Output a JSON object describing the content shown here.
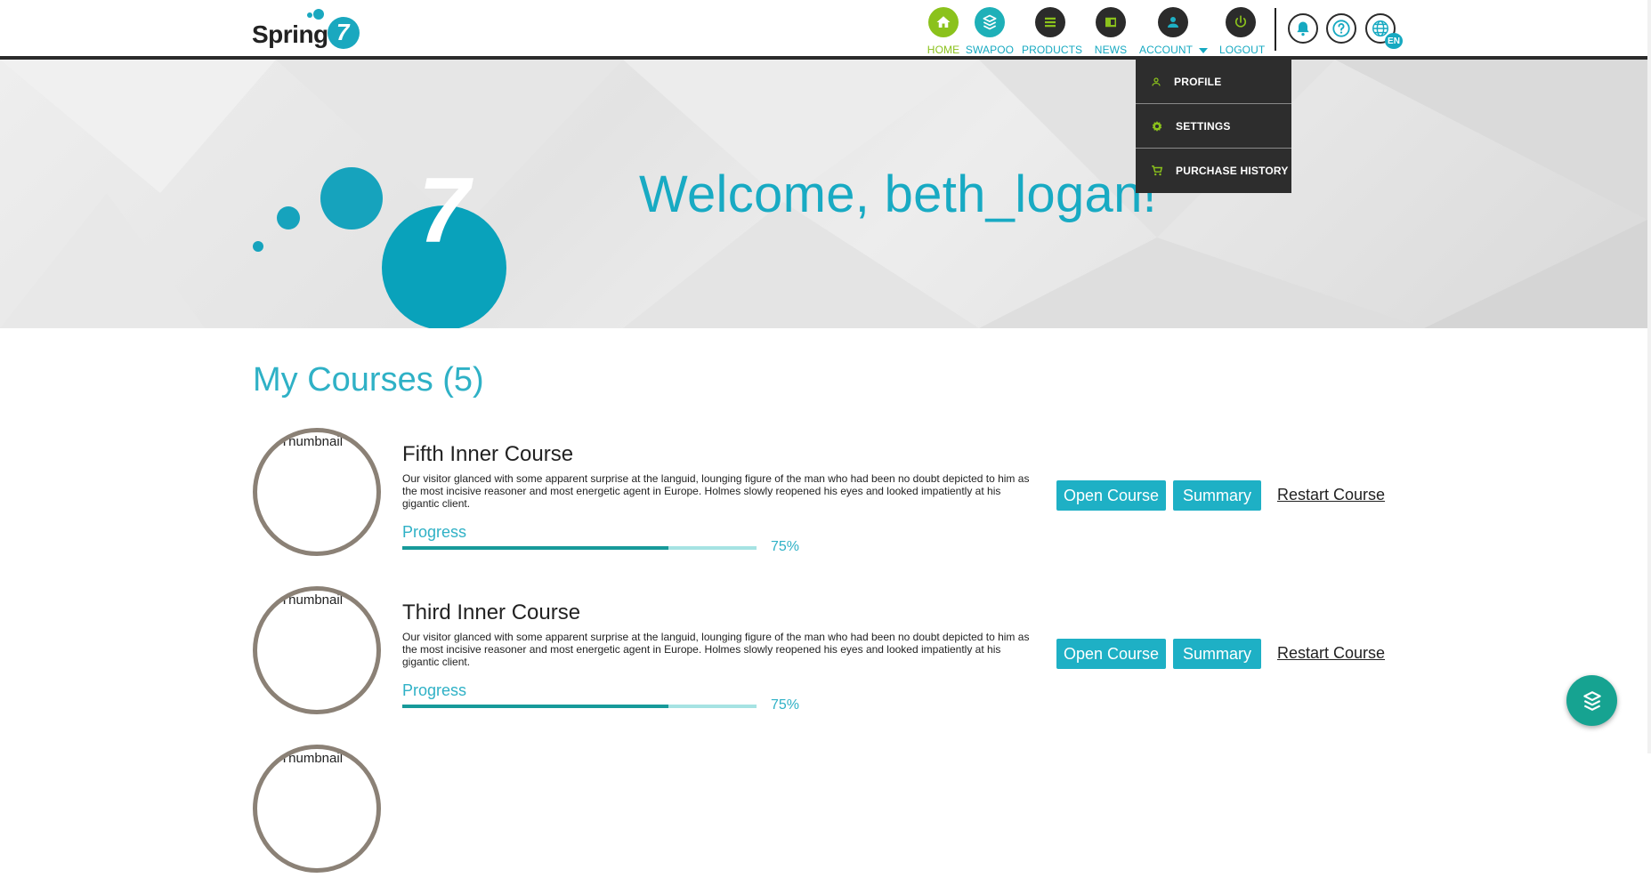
{
  "header": {
    "logo_text": "Spring",
    "logo_badge": "7",
    "nav": [
      {
        "label": "HOME",
        "icon": "home-icon",
        "color": "#8bc21c"
      },
      {
        "label": "SWAPOO",
        "icon": "swapoo-icon",
        "color": "#1eb0b8"
      },
      {
        "label": "PRODUCTS",
        "icon": "products-icon",
        "color": "#2b2b2b"
      },
      {
        "label": "NEWS",
        "icon": "news-icon",
        "color": "#2b2b2b"
      },
      {
        "label": "ACCOUNT",
        "icon": "account-icon",
        "color": "#2b2b2b"
      },
      {
        "label": "LOGOUT",
        "icon": "power-icon",
        "color": "#2b2b2b"
      }
    ],
    "utility": {
      "notifications_icon": "bell-icon",
      "help_icon": "question-icon",
      "language_icon": "globe-icon",
      "language_badge": "EN"
    }
  },
  "account_menu": {
    "items": [
      {
        "label": "PROFILE",
        "icon": "person-icon"
      },
      {
        "label": "SETTINGS",
        "icon": "gear-icon"
      },
      {
        "label": "PURCHASE HISTORY",
        "icon": "cart-icon"
      }
    ]
  },
  "hero": {
    "logo_badge": "7",
    "welcome": "Welcome, beth_logan!"
  },
  "courses": {
    "title": "My Courses (5)",
    "items": [
      {
        "thumb_alt": "Thumbnail",
        "name": "Fifth Inner Course",
        "description": "Our visitor glanced with some apparent surprise at the languid, lounging figure of the man who had been no doubt depicted to him as the most incisive reasoner and most energetic agent in Europe. Holmes slowly reopened his eyes and looked impatiently at his gigantic client.",
        "progress_label": "Progress",
        "progress": 0.75,
        "progress_text": "75%",
        "open_label": "Open Course",
        "summary_label": "Summary",
        "restart_label": "Restart Course"
      },
      {
        "thumb_alt": "Thumbnail",
        "name": "Third Inner Course",
        "description": "Our visitor glanced with some apparent surprise at the languid, lounging figure of the man who had been no doubt depicted to him as the most incisive reasoner and most energetic agent in Europe. Holmes slowly reopened his eyes and looked impatiently at his gigantic client.",
        "progress_label": "Progress",
        "progress": 0.75,
        "progress_text": "75%",
        "open_label": "Open Course",
        "summary_label": "Summary",
        "restart_label": "Restart Course"
      },
      {
        "thumb_alt": "Thumbnail"
      }
    ]
  },
  "fab": {
    "icon": "swapoo-icon"
  },
  "colors": {
    "accent": "#18aac3",
    "nav_active": "#8bc21c",
    "progress_fill": "#179a9a",
    "progress_track": "#a6e3e3",
    "menu_bg": "#2d2d2d",
    "fab": "#16a391"
  }
}
